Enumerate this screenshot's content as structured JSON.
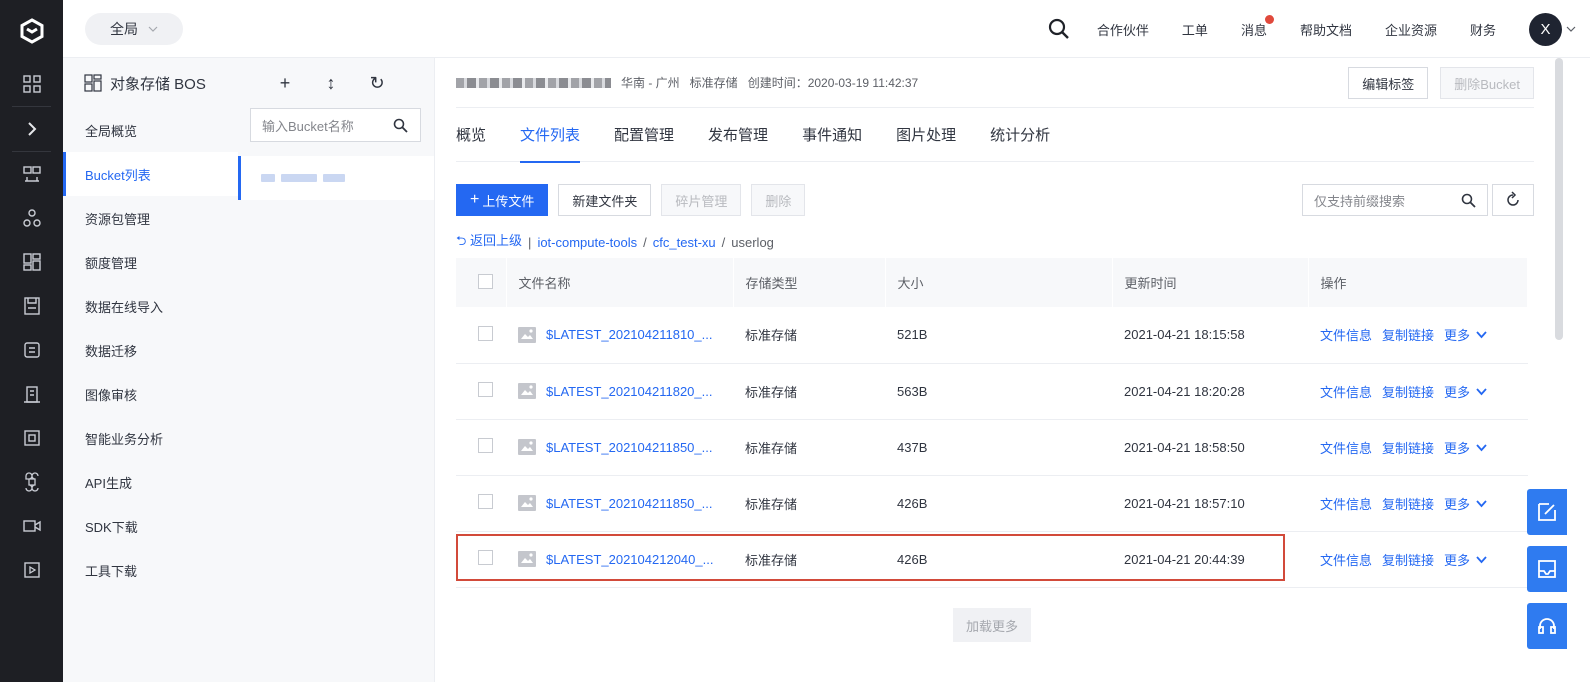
{
  "rail": {
    "icons": [
      "logo-icon",
      "grid-icon",
      "expand-icon",
      "products-icon",
      "network-icon",
      "dashboard-icon",
      "storage-icon",
      "database-icon",
      "building-icon",
      "frame-icon",
      "command-icon",
      "video-icon",
      "media-icon"
    ]
  },
  "topbar": {
    "region": "全局",
    "links": [
      "合作伙伴",
      "工单",
      "消息",
      "帮助文档",
      "企业资源",
      "财务"
    ],
    "avatar": "X"
  },
  "submenu": {
    "title": "对象存储 BOS",
    "items": [
      "全局概览",
      "Bucket列表",
      "资源包管理",
      "额度管理",
      "数据在线导入",
      "数据迁移",
      "图像审核",
      "智能业务分析",
      "API生成",
      "SDK下载",
      "工具下载"
    ],
    "active_index": 1
  },
  "buckets": {
    "search_placeholder": "输入Bucket名称"
  },
  "bucket_info": {
    "region": "华南 - 广州",
    "storage": "标准存储",
    "created": "创建时间：2020-03-19 11:42:37",
    "edit_tags": "编辑标签",
    "delete_bucket": "删除Bucket"
  },
  "tabs": [
    "概览",
    "文件列表",
    "配置管理",
    "发布管理",
    "事件通知",
    "图片处理",
    "统计分析"
  ],
  "toolbar": {
    "upload": "上传文件",
    "new_folder": "新建文件夹",
    "fragments": "碎片管理",
    "delete": "删除",
    "search_placeholder": "仅支持前缀搜索"
  },
  "breadcrumb": {
    "back": "返回上级",
    "parts": [
      "iot-compute-tools",
      "cfc_test-xu",
      "userlog"
    ]
  },
  "table": {
    "headers": [
      "文件名称",
      "存储类型",
      "大小",
      "更新时间",
      "操作"
    ],
    "rows": [
      {
        "name": "$LATEST_202104211810_...",
        "type": "标准存储",
        "size": "521B",
        "time": "2021-04-21 18:15:58"
      },
      {
        "name": "$LATEST_202104211820_...",
        "type": "标准存储",
        "size": "563B",
        "time": "2021-04-21 18:20:28"
      },
      {
        "name": "$LATEST_202104211850_...",
        "type": "标准存储",
        "size": "437B",
        "time": "2021-04-21 18:58:50"
      },
      {
        "name": "$LATEST_202104211850_...",
        "type": "标准存储",
        "size": "426B",
        "time": "2021-04-21 18:57:10"
      },
      {
        "name": "$LATEST_202104212040_...",
        "type": "标准存储",
        "size": "426B",
        "time": "2021-04-21 20:44:39"
      }
    ],
    "ops": {
      "info": "文件信息",
      "copy": "复制链接",
      "more": "更多"
    }
  },
  "load_more": "加载更多",
  "colors": {
    "accent": "#2468f2",
    "highlight": "#d24a3a",
    "rail": "#1e1f24"
  }
}
